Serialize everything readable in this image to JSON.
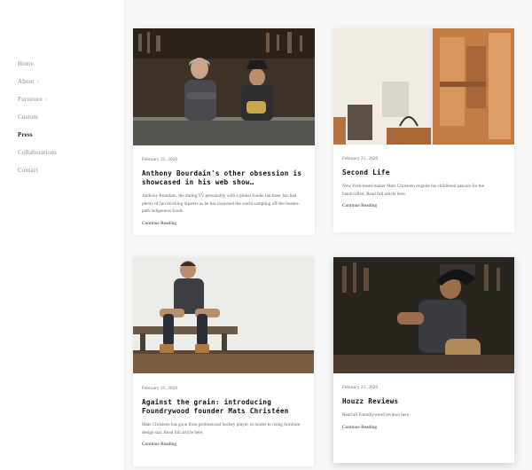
{
  "nav": [
    {
      "label": "Home",
      "has_submenu": false
    },
    {
      "label": "About",
      "has_submenu": true
    },
    {
      "label": "Furniture",
      "has_submenu": true
    },
    {
      "label": "Custom",
      "has_submenu": false
    },
    {
      "label": "Press",
      "has_submenu": false,
      "active": true
    },
    {
      "label": "Collaborations",
      "has_submenu": false
    },
    {
      "label": "Contact",
      "has_submenu": false
    }
  ],
  "chevron": "›",
  "posts": [
    {
      "date": "February 21, 2020",
      "title": "Anthony Bourdain's other obsession is showcased in his web show…",
      "excerpt": "Anthony Bourdain, the daring TV personality with a global foodie fan base, has had plenty of fun mocking hipsters as he has traversed the world sampling off-the-beaten-path indigenous foods.",
      "link": "Continue Reading"
    },
    {
      "date": "February 21, 2020",
      "title": "Second Life",
      "excerpt": "New York-based maker Mats Christeen reignite his childhood passion for the handcrafted. Read full article here.",
      "link": "Continue Reading"
    },
    {
      "date": "February 21, 2020",
      "title": "Against the grain: introducing Foundrywood founder Mats Christéen",
      "excerpt": "Mats Christeen has gone from professional hockey player, to model to rising furniture design star. Read full article here.",
      "link": "Continue Reading"
    },
    {
      "date": "February 21, 2020",
      "title": "Houzz Reviews",
      "excerpt": "Read all Foundrywood reviews here",
      "link": "Continue Reading"
    }
  ]
}
